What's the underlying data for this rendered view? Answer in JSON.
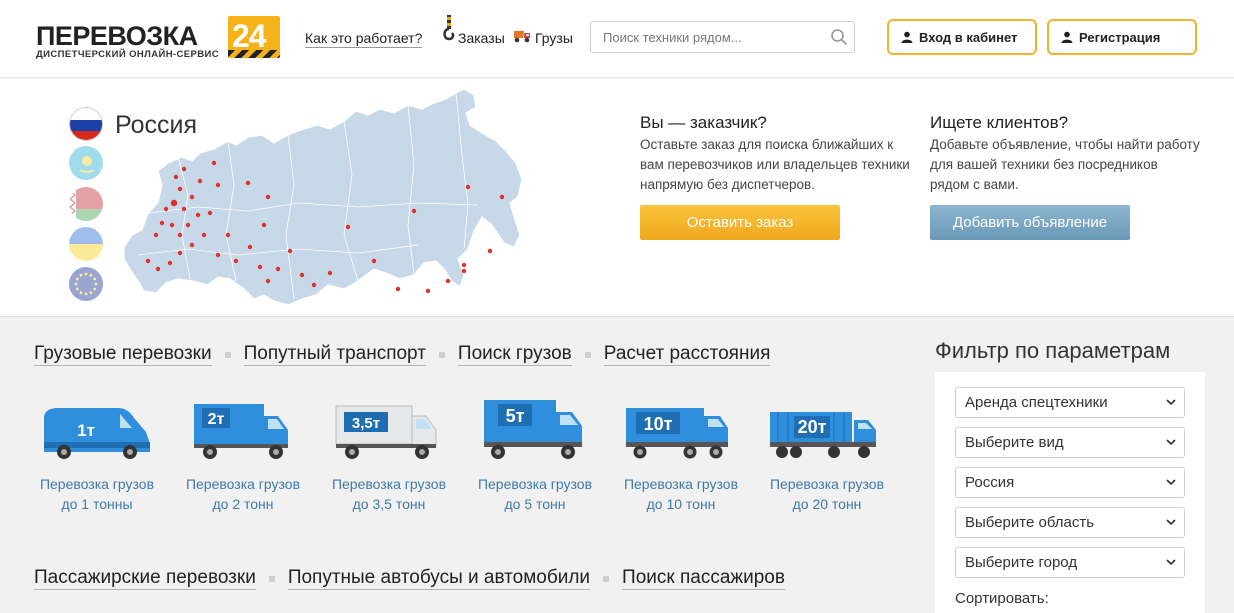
{
  "header": {
    "logo_word": "ПЕРЕВОЗКА",
    "logo_number": "24",
    "logo_subtitle": "ДИСПЕТЧЕРСКИЙ ОНЛАЙН-СЕРВИС",
    "how_it_works": "Как это работает?",
    "orders": "Заказы",
    "cargo": "Грузы",
    "search_placeholder": "Поиск техники рядом...",
    "login": "Вход в кабинет",
    "register": "Регистрация"
  },
  "hero": {
    "country": "Россия",
    "flags": [
      "russia-flag-icon",
      "kazakhstan-flag-icon",
      "belarus-flag-icon",
      "ukraine-flag-icon",
      "eu-flag-icon"
    ],
    "customer": {
      "title": "Вы — заказчик?",
      "text": "Оставьте заказ для поиска ближайших к вам перевозчиков или владельцев техники напрямую без диспетчеров.",
      "button": "Оставить заказ"
    },
    "provider": {
      "title": "Ищете клиентов?",
      "text": "Добавьте объявление, чтобы найти работу для вашей техники без посредников рядом с вами.",
      "button": "Добавить объявление"
    }
  },
  "cargo_categories": [
    "Грузовые перевозки",
    "Попутный транспорт",
    "Поиск грузов",
    "Расчет расстояния"
  ],
  "trucks": [
    {
      "badge": "1т",
      "line1": "Перевозка грузов",
      "line2": "до 1 тонны"
    },
    {
      "badge": "2т",
      "line1": "Перевозка грузов",
      "line2": "до 2 тонн"
    },
    {
      "badge": "3,5т",
      "line1": "Перевозка грузов",
      "line2": "до 3,5 тонн"
    },
    {
      "badge": "5т",
      "line1": "Перевозка грузов",
      "line2": "до 5 тонн"
    },
    {
      "badge": "10т",
      "line1": "Перевозка грузов",
      "line2": "до 10 тонн"
    },
    {
      "badge": "20т",
      "line1": "Перевозка грузов",
      "line2": "до 20 тонн"
    }
  ],
  "passenger_categories": [
    "Пассажирские перевозки",
    "Попутные автобусы и автомобили",
    "Поиск пассажиров"
  ],
  "filter": {
    "title": "Фильтр по параметрам",
    "selects": [
      "Аренда спецтехники",
      "Выберите вид",
      "Россия",
      "Выберите область",
      "Выберите город"
    ],
    "sort_label": "Сортировать:"
  },
  "colors": {
    "accent_orange": "#f0a81d",
    "accent_blue": "#6b99b8",
    "link_blue": "#3f79a7",
    "truck_blue": "#2f8fdc"
  }
}
